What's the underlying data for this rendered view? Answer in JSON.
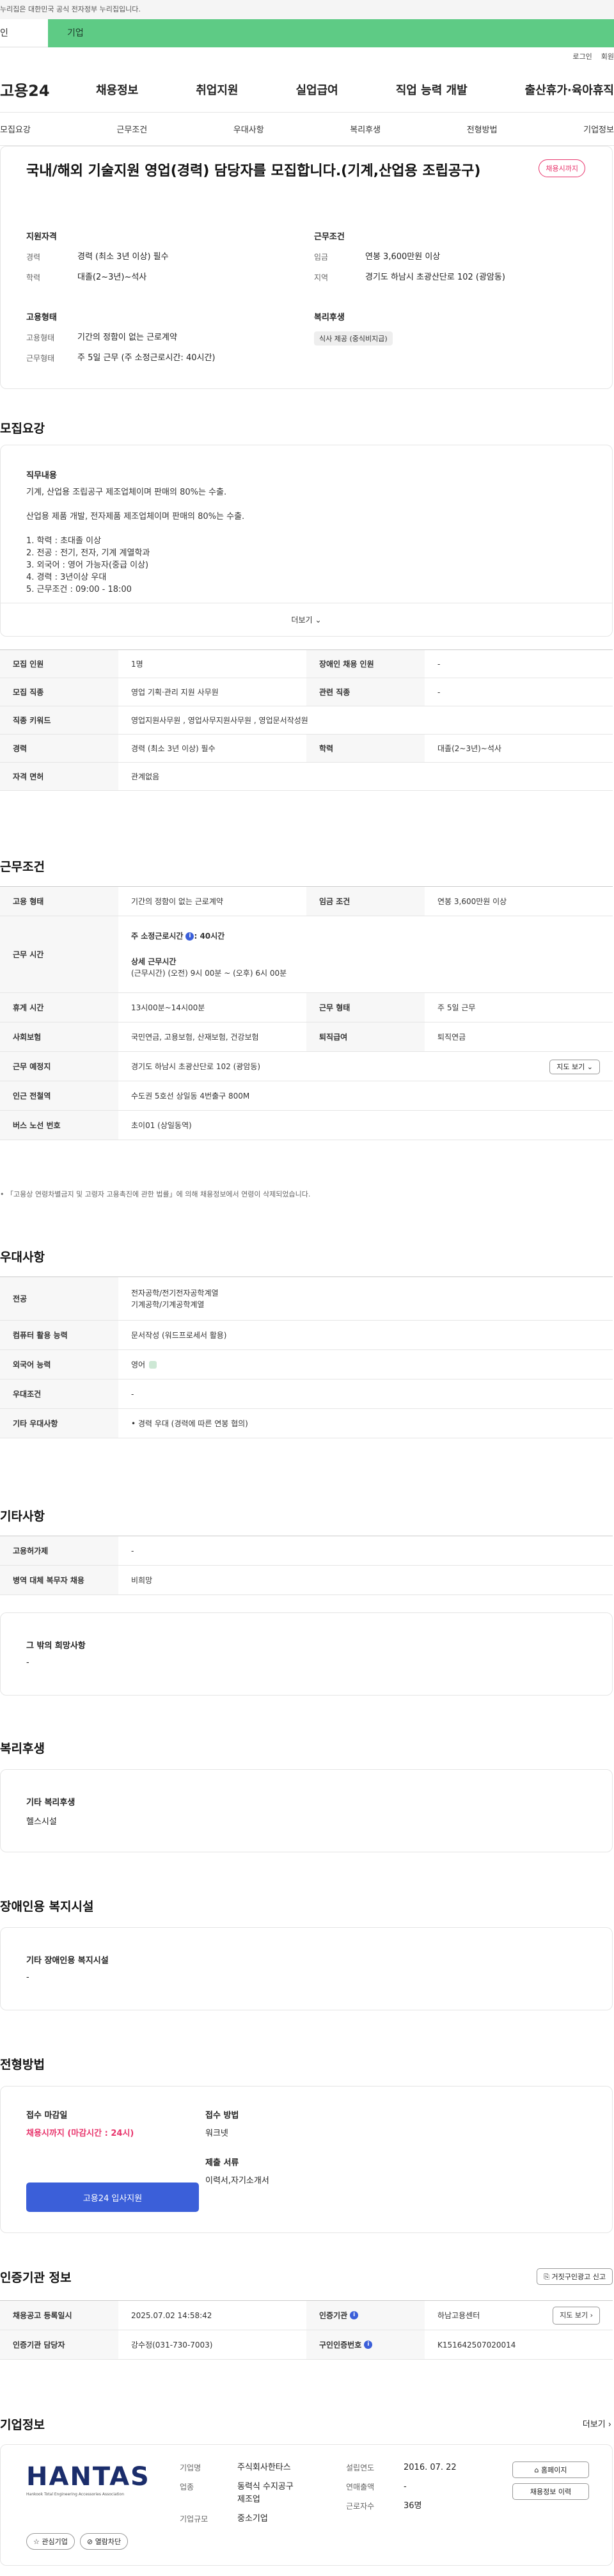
{
  "gov_banner": "누리집은 대한민국 공식 전자정부 누리집입니다.",
  "site_tabs": {
    "person": "인",
    "corp": "기업"
  },
  "util_links": [
    "로그인",
    "회원"
  ],
  "logo": "고용24",
  "gnb": [
    "채용정보",
    "취업지원",
    "실업급여",
    "직업 능력 개발",
    "출산휴가·육아휴직"
  ],
  "anchors": [
    "모집요강",
    "근무조건",
    "우대사항",
    "복리후생",
    "전형방법",
    "기업정보"
  ],
  "summary": {
    "title": "국내/해외 기술지원 영업(경력) 담당자를 모집합니다.(기계,산업용 조립공구)",
    "deadline_badge": "채용시까지",
    "qual_title": "지원자격",
    "qual": [
      {
        "k": "경력",
        "v": "경력 (최소 3년 이상) 필수"
      },
      {
        "k": "학력",
        "v": "대졸(2~3년)~석사"
      }
    ],
    "cond_title": "근무조건",
    "cond": [
      {
        "k": "임금",
        "v": "연봉 3,600만원 이상"
      },
      {
        "k": "지역",
        "v": "경기도 하남시 초광산단로 102 (광암동)"
      }
    ],
    "type_title": "고용형태",
    "type": [
      {
        "k": "고용형태",
        "v": "기간의 정함이 없는 근로계약"
      },
      {
        "k": "근무형태",
        "v": "주 5일 근무 (주 소정근로시간: 40시간)"
      }
    ],
    "welfare_title": "복리후생",
    "welfare_chip": "식사 제공 (중식비지급)"
  },
  "recruit": {
    "title": "모집요강",
    "duty_title": "직무내용",
    "duty_lines": [
      "기계, 산업용 조립공구 제조업체이며 판매의 80%는 수출.",
      "",
      "산업용 제품 개발, 전자제품 제조업체이며 판매의 80%는 수출.",
      "",
      "1. 학력 : 초대졸 이상",
      "2. 전공 : 전기, 전자, 기계 계열학과",
      "3. 외국어 : 영어 가능자(중급 이상)",
      "4. 경력 : 3년이상 우대",
      "5. 근무조건 : 09:00 - 18:00"
    ],
    "more": "더보기",
    "rows": [
      [
        {
          "k": "모집 인원",
          "v": "1명"
        },
        {
          "k": "장애인 채용 인원",
          "v": "-"
        }
      ],
      [
        {
          "k": "모집 직종",
          "v": "영업 기획·관리 지원 사무원"
        },
        {
          "k": "관련 직종",
          "v": "-"
        }
      ],
      [
        {
          "k": "직종 키워드",
          "v": "영업지원사무원 , 영업사무지원사무원 , 영업문서작성원"
        }
      ],
      [
        {
          "k": "경력",
          "v": "경력 (최소 3년 이상) 필수"
        },
        {
          "k": "학력",
          "v": "대졸(2~3년)~석사"
        }
      ],
      [
        {
          "k": "자격 면허",
          "v": "관계없음"
        }
      ]
    ]
  },
  "work": {
    "title": "근무조건",
    "emp_k": "고용 형태",
    "emp_v": "기간의 정함이 없는 근로계약",
    "wage_k": "임금 조건",
    "wage_v": "연봉 3,600만원 이상",
    "hours_k": "근무 시간",
    "hours_weekly": "주 소정근로시간",
    "hours_weekly_v": ": 40시간",
    "hours_detail_title": "상세 근무시간",
    "hours_detail": "(근무시간) (오전) 9시 00분 ~ (오후) 6시 00분",
    "break_k": "휴게 시간",
    "break_v": "13시00분~14시00분",
    "shift_k": "근무 형태",
    "shift_v": "주 5일 근무",
    "ins_k": "사회보험",
    "ins_v": "국민연금, 고용보험, 산재보험, 건강보험",
    "ret_k": "퇴직급여",
    "ret_v": "퇴직연금",
    "place_k": "근무 예정지",
    "place_v": "경기도 하남시 초광산단로 102 (광암동)",
    "map_btn": "지도 보기",
    "subway_k": "인근 전철역",
    "subway_v": "수도권 5호선 상일동 4번출구 800M",
    "bus_k": "버스 노선 번호",
    "bus_v": "초이01 (상일동역)",
    "note": "• 「고용상 연령차별금지 및 고령자 고용촉진에 관한 법률」에 의해 채용정보에서 연령이 삭제되었습니다."
  },
  "pref": {
    "title": "우대사항",
    "rows": [
      {
        "k": "전공",
        "v": "전자공학/전기전자공학계열",
        "v2": "기계공학/기계공학계열"
      },
      {
        "k": "컴퓨터 활용 능력",
        "v": "문서작성 (워드프로세서 활용)"
      },
      {
        "k": "외국어 능력",
        "v": "영어"
      },
      {
        "k": "우대조건",
        "v": "-"
      },
      {
        "k": "기타 우대사항",
        "v": "• 경력 우대 (경력에 따른 연봉 협의)"
      }
    ]
  },
  "etc": {
    "title": "기타사항",
    "rows": [
      {
        "k": "고용허가제",
        "v": "-"
      },
      {
        "k": "병역 대체 복무자 채용",
        "v": "비희망"
      }
    ],
    "extra_title": "그 밖의 희망사항",
    "extra_v": "-"
  },
  "welfare": {
    "title": "복리후생",
    "sub": "기타 복리후생",
    "v": "헬스시설"
  },
  "disabled": {
    "title": "장애인용 복지시설",
    "sub": "기타 장애인용 복지시설",
    "v": "-"
  },
  "process": {
    "title": "전형방법",
    "deadline_k": "접수 마감일",
    "deadline_v": "채용시까지 (마감시간 : 24시)",
    "apply_btn": "고용24 입사지원",
    "method_k": "접수 방법",
    "method_v": "워크넷",
    "docs_k": "제출 서류",
    "docs_v": "이력서,자기소개서"
  },
  "auth": {
    "title": "인증기관 정보",
    "report_btn": "거짓구인광고 신고",
    "rows": [
      [
        {
          "k": "채용공고 등록일시",
          "v": "2025.07.02 14:58:42"
        },
        {
          "k": "인증기관",
          "v": "하남고용센터"
        }
      ],
      [
        {
          "k": "인증기관 담당자",
          "v": "강수정(031-730-7003)"
        },
        {
          "k": "구인인증번호",
          "v": "K151642507020014"
        }
      ]
    ],
    "map_btn": "지도 보기"
  },
  "company": {
    "title": "기업정보",
    "more": "더보기",
    "logo_text": "HANTAS",
    "logo_sub": "Hankook Total Engineering Accessories Association",
    "interest_btn": "관심기업",
    "block_btn": "열람차단",
    "rows": [
      {
        "k": "기업명",
        "v": "주식회사한타스"
      },
      {
        "k": "업종",
        "v": "동력식 수지공구",
        "v2": "제조업"
      },
      {
        "k": "기업규모",
        "v": "중소기업"
      }
    ],
    "rows2": [
      {
        "k": "설립연도",
        "v": "2016. 07. 22"
      },
      {
        "k": "연매출액",
        "v": "-"
      },
      {
        "k": "근로자수",
        "v": "36명"
      }
    ],
    "home_btn": "홈페이지",
    "jobs_btn": "채용정보 이력"
  },
  "colors": {
    "accent": "#5ecb85",
    "primary": "#3b5fd9",
    "alert": "#e8356c"
  }
}
